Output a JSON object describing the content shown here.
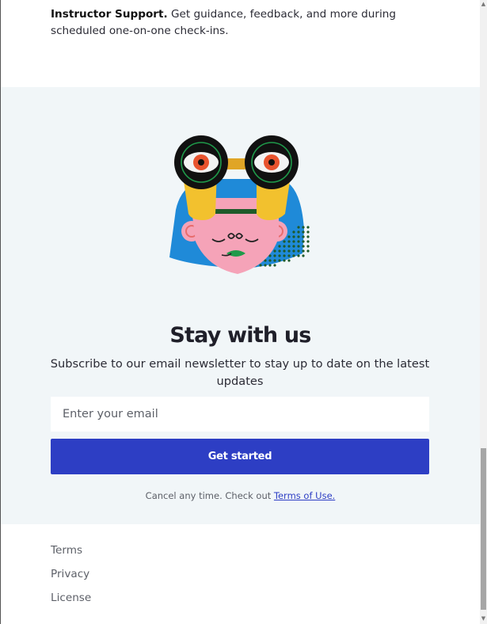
{
  "intro": {
    "bold": "Instructor Support.",
    "text": " Get guidance, feedback, and more during scheduled one-on-one check-ins."
  },
  "newsletter": {
    "illustration": "binoculars-face-illustration",
    "title": "Stay with us",
    "description": "Subscribe to our email newsletter to stay up to date on the latest updates",
    "email_placeholder": "Enter your email",
    "button_label": "Get started",
    "cancel_text": "Cancel any time. Check out ",
    "terms_link": "Terms of Use."
  },
  "footer": {
    "links": [
      "Terms",
      "Privacy",
      "License"
    ]
  },
  "colors": {
    "accent": "#2d3ec4",
    "section_bg": "#f1f6f8"
  }
}
